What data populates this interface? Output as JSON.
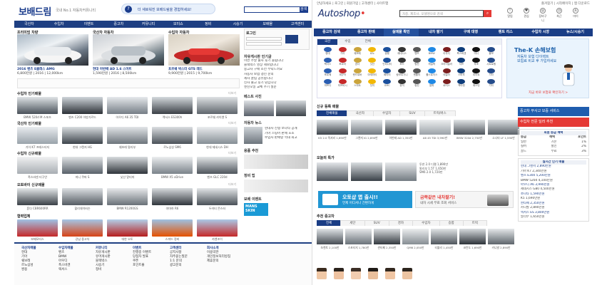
{
  "left": {
    "logo": "보배드림",
    "logo_sub": "국내 No.1 자동차커뮤니티",
    "banner_text": "더 새로워진 보배드림을 경험하세요!",
    "banner_icon": "?",
    "search_button": "검색",
    "nav": [
      "국산차",
      "수입차",
      "이벤트",
      "중고차",
      "커뮤니티",
      "모터쇼",
      "정비",
      "시승기",
      "보배몰",
      "고객센터"
    ],
    "section_premium": "프리미엄 차량",
    "section_premium_2": "국산차 자동차",
    "section_premium_3": "수입차 자동차",
    "more": "더보기",
    "big_caps": [
      {
        "line1": "2016 벤츠 E클래스 AMG",
        "line2": "6,800만원 | 2016 | 12,000km"
      },
      {
        "line1": "현대 아반떼 AD 1.6 스마트",
        "line2": "1,590만원 | 2016 | 8,500km"
      },
      {
        "line1": "포르쉐 박스터 GTS 레드",
        "line2": "9,900만원 | 2015 | 9,700km"
      }
    ],
    "rows": [
      {
        "title": "수입차 인기매물",
        "caps": [
          "BMW 520d M 스포츠",
          "벤츠 C200 아방가르드",
          "아우디 A6 35 TDI",
          "렉서스 ES300h",
          "포르쉐 카이엔 S"
        ]
      },
      {
        "title": "국산차 인기매물",
        "caps": [
          "기아 K7 프레스티지",
          "현대 그랜저 HG",
          "쉐보레 말리부",
          "르노삼성 SM6",
          "현대 제네시스 DH"
        ]
      },
      {
        "title": "수입차 신규매물",
        "caps": [
          "폭스바겐 티구안",
          "미니 쿠퍼 S",
          "닛산 알티마",
          "BMW X5 xDrive",
          "벤츠 GLC 220d"
        ]
      },
      {
        "title": "오토바이 신규매물",
        "caps": [
          "혼다 CBR600RR",
          "할리데이비슨",
          "BMW R1200GS",
          "야마하 R6",
          "두카티 몬스터"
        ]
      },
      {
        "title": "협력업체",
        "caps": [
          "보배모터스",
          "강남 중고차",
          "대한 오토",
          "스피드 정비",
          "카앤조이"
        ]
      }
    ],
    "side": {
      "login_title": "로그인",
      "list1_title": "자유게시판 인기글",
      "list1": [
        "이번 주말 출사 후기 올립니다",
        "블랙박스 영상 제보합니다",
        "중고차 구매 조언 부탁드려요",
        "자동차 보험 갱신 문의",
        "세차 꿀팁 공유합니다",
        "신차 출고 후기 남깁니다",
        "엔진오일 교체 주기 질문"
      ],
      "list2_title": "베스트 사진",
      "list3_title": "자동차 뉴스",
      "list3": [
        "현대차 신형 쏘나타 공개",
        "기아 스팅어 판매 호조",
        "수입차 판매량 역대 최고"
      ],
      "list4_title": "용품 추천",
      "list5_title": "정비 팁",
      "list6_title": "보배 이벤트",
      "mans": "MANS SKIN"
    },
    "footer": [
      {
        "title": "국산차매물",
        "items": [
          "현대",
          "기아",
          "쉐보레",
          "르노삼성",
          "쌍용"
        ]
      },
      {
        "title": "수입차매물",
        "items": [
          "벤츠",
          "BMW",
          "아우디",
          "폭스바겐",
          "렉서스"
        ]
      },
      {
        "title": "커뮤니티",
        "items": [
          "자유게시판",
          "유머게시판",
          "블랙박스",
          "시승기",
          "정비"
        ]
      },
      {
        "title": "이벤트",
        "items": [
          "진행중 이벤트",
          "당첨자 발표",
          "쿠폰",
          "포인트몰"
        ]
      },
      {
        "title": "고객센터",
        "items": [
          "공지사항",
          "자주묻는질문",
          "1:1 문의",
          "광고문의"
        ]
      },
      {
        "title": "회사소개",
        "items": [
          "이용약관",
          "개인정보처리방침",
          "제휴문의"
        ]
      }
    ]
  },
  "right": {
    "topbar": "안녕하세요 | 로그인 | 회원가입 | 고객센터 | 사이트맵",
    "topbar_right": "즐겨찾기 | 시작페이지 | 앱 다운로드",
    "logo": "Autoshop",
    "search_placeholder": "차종, 제조사, 모델명으로 검색",
    "icons": [
      {
        "icon": "alarm-icon",
        "label": "알림",
        "glyph": "!"
      },
      {
        "icon": "heart-icon",
        "label": "관심",
        "glyph": "♥"
      },
      {
        "icon": "cart-icon",
        "label": "장바구니",
        "glyph": "◎"
      },
      {
        "icon": "history-icon",
        "label": "최근",
        "glyph": "◷"
      },
      {
        "icon": "user-icon",
        "label": "마이",
        "glyph": "♙"
      }
    ],
    "nav": [
      "중고차 검색",
      "중고차 판매",
      "실매물 확인",
      "내차 팔기",
      "구매 대행",
      "렌트 리스",
      "수입차 시장",
      "뉴스/시승기"
    ],
    "brand_tabs": [
      "국산",
      "수입",
      "전체"
    ],
    "brands": [
      "현대",
      "기아",
      "쉐보레",
      "르노",
      "쌍용",
      "제네시스",
      "벤츠",
      "BMW",
      "아우디",
      "폭스바겐",
      "미니",
      "볼보",
      "렉서스",
      "토요타",
      "혼다",
      "닛산",
      "인피니티",
      "포드",
      "링컨",
      "캐딜락",
      "크라이슬러",
      "지프",
      "푸조",
      "시트로엥",
      "포르쉐",
      "재규어",
      "랜드로버",
      "마세라티",
      "페라리",
      "람보르기니",
      "벤틀리",
      "롤스로이스",
      "테슬라",
      "스바루",
      "피아트",
      "기타",
      "마쯔다",
      "미쯔비시",
      "스마트",
      "닷지",
      "GMC",
      "뷰익",
      "링컨",
      "알파",
      "로터스",
      "맥라렌",
      "애스턴",
      "기타"
    ],
    "brand_colors": [
      "#2a5db0",
      "#c62828",
      "#caa43b",
      "#f2b705",
      "#1a4f9c",
      "#333333",
      "#555555",
      "#1e88e5",
      "#7b1d1d",
      "#0d3c7a",
      "#111111",
      "#244b8a"
    ],
    "ad": {
      "title": "The-K 손해보험",
      "sub1": "자동차 보험 다이렉트",
      "sub2": "보험료 비교 후 가입하세요",
      "foot": "지금 바로 보험료 확인하기 >"
    },
    "section_new": "신규 등록 매물",
    "new_tabs": [
      "전체매물",
      "국산차",
      "수입차",
      "SUV",
      "트럭/버스"
    ],
    "new_caps": [
      "K5 2.0 럭셔리 1,690만",
      "그랜저 IG 2,890만",
      "아반떼 AD 1,350만",
      "A6 45 TDI 3,990만",
      "BMW 320d 2,750만",
      "소나타 LF 1,590만"
    ],
    "section_special": "오늘의 특가",
    "special_caps": [
      "투싼 2.0 디젤 1,890만",
      "말리부 1.5T 1,650만",
      "SM6 2.0 1,720만"
    ],
    "promo": {
      "line1": "오토샵 앱 출시!!",
      "line2": "언제 어디서나 간편하게"
    },
    "promo2": {
      "line1": "금쪽같은 내차팔기!",
      "line2": "내차 시세 무료 조회 서비스"
    },
    "section_pick": "추천 중고차",
    "pick_tabs": [
      "전체",
      "세단",
      "SUV",
      "경차",
      "수입차",
      "승합",
      "트럭"
    ],
    "pick_caps": [
      "쏘렌토 2,100만",
      "스포티지 1,780만",
      "싼타페 2,350만",
      "QM6 2,050만",
      "티볼리 1,450만",
      "코란도 1,690만",
      "카니발 2,890만"
    ],
    "side": {
      "banner1": "중고차 무사고 보증 서비스",
      "banner2": "수입차 전문 딜러 추천",
      "notice_title": "회원 등급 혜택",
      "grade_head": [
        "등급",
        "혜택",
        "포인트"
      ],
      "grades": [
        [
          "일반",
          "기본",
          "1%"
        ],
        [
          "실버",
          "할인",
          "2%"
        ],
        [
          "골드",
          "무료",
          "3%"
        ]
      ],
      "list_title": "실시간 인기 매물",
      "list": [
        "현대 그랜저 2,890만원",
        "기아 K7 2,340만원",
        "벤츠 E300 5,200만원",
        "BMW 520d 4,100만원",
        "아우디 A6 3,990만원",
        "제네시스 G80 4,500만원",
        "쏘나타 1,590만원",
        "K5 1,690만원",
        "싼타페 2,350만원",
        "카니발 2,890만원",
        "렉서스 ES 3,800만원",
        "말리부 1,650만원"
      ]
    }
  }
}
